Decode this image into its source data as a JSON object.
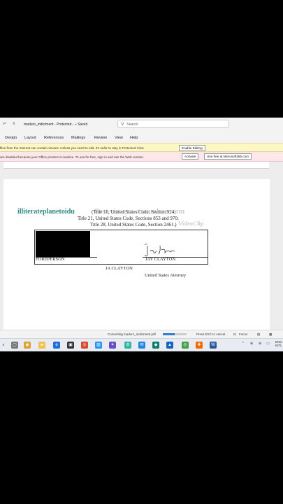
{
  "window": {
    "title": "maduro_indictment  -  Protected...  •  Saved",
    "search_placeholder": "Search"
  },
  "ribbon": {
    "tabs": [
      "Design",
      "Layout",
      "References",
      "Mailings",
      "Review",
      "View",
      "Help"
    ]
  },
  "protected_bar": {
    "message": "files from the Internet can contain viruses. Unless you need to edit, it's safer to stay in Protected View.",
    "button": "Enable Editing"
  },
  "license_bar": {
    "message": "are disabled because your Office product is inactive. To use for free, sign in and use the Web version.",
    "activate": "Activate",
    "web_button": "Use free at Microsoft365.com"
  },
  "document": {
    "citation_1": "(Title 18, United States Code, Section 924;",
    "citation_2": "Title 21, United States Code, Sections 853 and 970;",
    "citation_3": "Title 28, United States Code, Section 2461.)",
    "foreperson_label": "FOREPERSON",
    "attorney_signature_label": "JAY CLAYTON",
    "attorney_name": "JA CLAYTON",
    "attorney_title": "United States Attorney"
  },
  "watermarks": {
    "channel": "illiterateplanetoidu",
    "site": "Best viewers streamhoo .com",
    "tag": "VideoClip"
  },
  "status_bar": {
    "converting": "Converting maduro_indictment.pdf",
    "progress_fraction": 0.5,
    "cancel_hint": "Press ESC to cancel.",
    "focus": "Focus"
  },
  "taskbar": {
    "lang_1": "ENG",
    "lang_2": "INTL"
  },
  "colors": {
    "protected_bar": "#fdf6c5",
    "license_bar": "#fde7e9",
    "watermark_teal": "#3a8f8a",
    "word_blue": "#2b579a"
  }
}
